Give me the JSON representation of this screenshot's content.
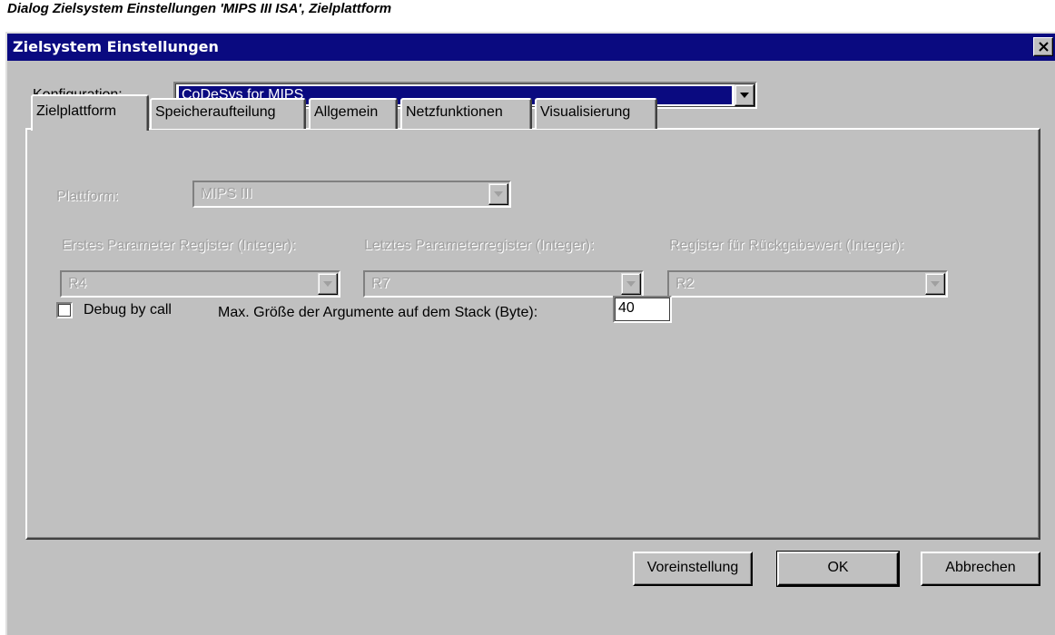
{
  "caption": "Dialog Zielsystem Einstellungen 'MIPS III ISA', Zielplattform",
  "window": {
    "title": "Zielsystem Einstellungen",
    "close_icon": "close-icon"
  },
  "configuration": {
    "label": "Konfiguration:",
    "value": "CoDeSys for MIPS"
  },
  "tabs": [
    {
      "label": "Zielplattform",
      "active": true
    },
    {
      "label": "Speicheraufteilung",
      "active": false
    },
    {
      "label": "Allgemein",
      "active": false
    },
    {
      "label": "Netzfunktionen",
      "active": false
    },
    {
      "label": "Visualisierung",
      "active": false
    }
  ],
  "platform": {
    "label": "Plattform:",
    "value": "MIPS III"
  },
  "registers": {
    "first_param_label": "Erstes Parameter Register (Integer):",
    "first_param_value": "R4",
    "last_param_label": "Letztes Parameterregister (Integer):",
    "last_param_value": "R7",
    "return_label": "Register für Rückgabewert (Integer):",
    "return_value": "R2"
  },
  "debug": {
    "label": "Debug by call",
    "checked": false
  },
  "stack": {
    "label": "Max. Größe der Argumente auf dem Stack (Byte):",
    "value": "40"
  },
  "buttons": {
    "defaults": "Voreinstellung",
    "ok": "OK",
    "cancel": "Abbrechen"
  },
  "colors": {
    "titlebar": "#0a0a80",
    "face": "#c0c0c0",
    "disabled_text": "#a0a0a0"
  }
}
